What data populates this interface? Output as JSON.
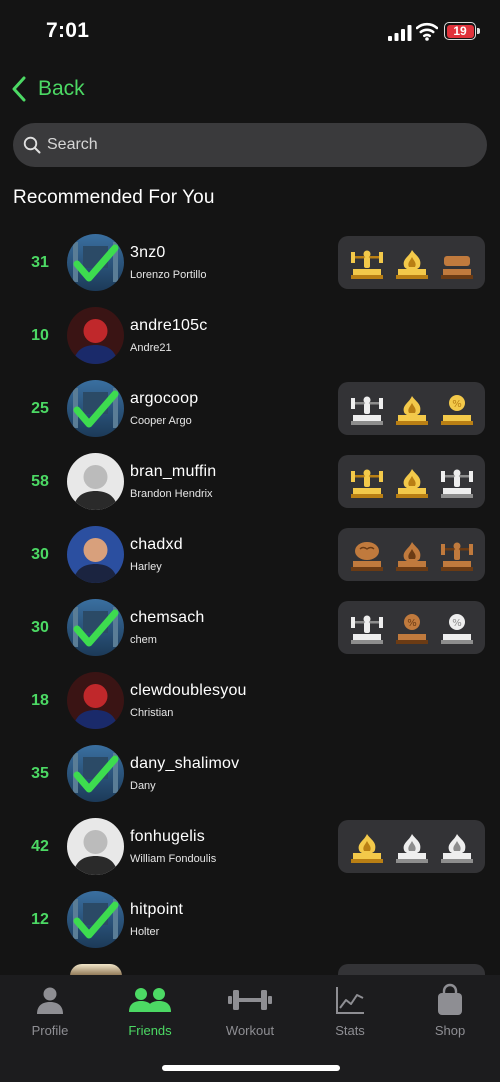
{
  "status": {
    "time": "7:01",
    "battery": "19"
  },
  "nav": {
    "back_label": "Back"
  },
  "search": {
    "placeholder": "Search"
  },
  "section": {
    "title": "Recommended For You"
  },
  "users": [
    {
      "rank": "31",
      "username": "3nz0",
      "name": "Lorenzo Portillo",
      "avatar": "checkmark-gym",
      "trophies": [
        "gold-lifter",
        "gold-flame",
        "bronze-plank"
      ]
    },
    {
      "rank": "10",
      "username": "andre105c",
      "name": "Andre21",
      "avatar": "photo",
      "trophies": []
    },
    {
      "rank": "25",
      "username": "argocoop",
      "name": "Cooper Argo",
      "avatar": "checkmark-gym",
      "trophies": [
        "silver-lifter",
        "gold-flame",
        "gold-percent"
      ]
    },
    {
      "rank": "58",
      "username": "bran_muffin",
      "name": "Brandon Hendrix",
      "avatar": "photo",
      "trophies": [
        "gold-lifter",
        "gold-flame",
        "silver-lifter"
      ]
    },
    {
      "rank": "30",
      "username": "chadxd",
      "name": "Harley",
      "avatar": "photo",
      "trophies": [
        "bronze-brain",
        "bronze-flames",
        "bronze-barbell"
      ]
    },
    {
      "rank": "30",
      "username": "chemsach",
      "name": "chem",
      "avatar": "checkmark-gym",
      "trophies": [
        "silver-barbell",
        "bronze-percent",
        "silver-percent"
      ]
    },
    {
      "rank": "18",
      "username": "clewdoublesyou",
      "name": "Christian",
      "avatar": "photo",
      "trophies": []
    },
    {
      "rank": "35",
      "username": "dany_shalimov",
      "name": "Dany",
      "avatar": "checkmark-gym",
      "trophies": []
    },
    {
      "rank": "42",
      "username": "fonhugelis",
      "name": "William Fondoulis",
      "avatar": "photo",
      "trophies": [
        "gold-flame",
        "silver-flames",
        "silver-flames"
      ]
    },
    {
      "rank": "12",
      "username": "hitpoint",
      "name": "Holter",
      "avatar": "checkmark-gym",
      "trophies": []
    }
  ],
  "tabs": [
    {
      "label": "Profile",
      "icon": "person-icon"
    },
    {
      "label": "Friends",
      "icon": "friends-icon",
      "active": true
    },
    {
      "label": "Workout",
      "icon": "dumbbell-icon"
    },
    {
      "label": "Stats",
      "icon": "chart-icon"
    },
    {
      "label": "Shop",
      "icon": "bag-icon"
    }
  ],
  "colors": {
    "accent": "#4cd964",
    "background": "#141414",
    "battery_low": "#e0323b",
    "gold": "#d8a52a",
    "silver": "#c9c9c9",
    "bronze": "#a0642c"
  }
}
